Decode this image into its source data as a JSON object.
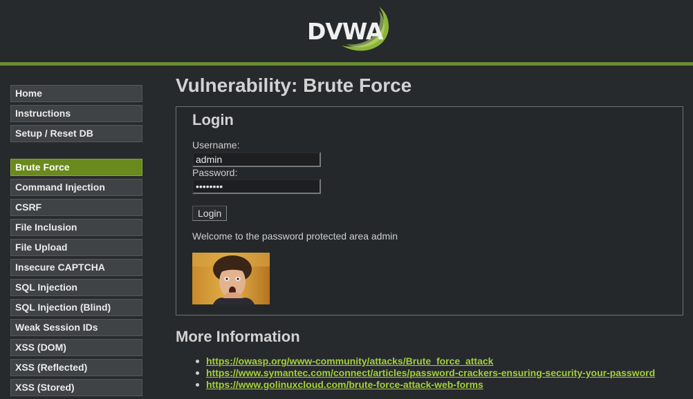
{
  "header": {
    "logo_text": "DVWA",
    "accent_color": "#6a8c2f"
  },
  "sidebar": {
    "top_items": [
      {
        "label": "Home"
      },
      {
        "label": "Instructions"
      },
      {
        "label": "Setup / Reset DB"
      }
    ],
    "vuln_items": [
      {
        "label": "Brute Force",
        "active": true
      },
      {
        "label": "Command Injection"
      },
      {
        "label": "CSRF"
      },
      {
        "label": "File Inclusion"
      },
      {
        "label": "File Upload"
      },
      {
        "label": "Insecure CAPTCHA"
      },
      {
        "label": "SQL Injection"
      },
      {
        "label": "SQL Injection (Blind)"
      },
      {
        "label": "Weak Session IDs"
      },
      {
        "label": "XSS (DOM)"
      },
      {
        "label": "XSS (Reflected)"
      },
      {
        "label": "XSS (Stored)"
      }
    ],
    "active_color": "#6a8a1d"
  },
  "main": {
    "title": "Vulnerability: Brute Force",
    "login": {
      "title": "Login",
      "username_label": "Username:",
      "username_value": "admin",
      "password_label": "Password:",
      "password_value": "••••••••",
      "button_label": "Login",
      "welcome_message": "Welcome to the password protected area admin",
      "avatar_icon": "user-photo-icon"
    },
    "more_info": {
      "title": "More Information",
      "links": [
        "https://owasp.org/www-community/attacks/Brute_force_attack",
        "https://www.symantec.com/connect/articles/password-crackers-ensuring-security-your-password",
        "https://www.golinuxcloud.com/brute-force-attack-web-forms"
      ],
      "link_color": "#a4cf3c"
    }
  }
}
